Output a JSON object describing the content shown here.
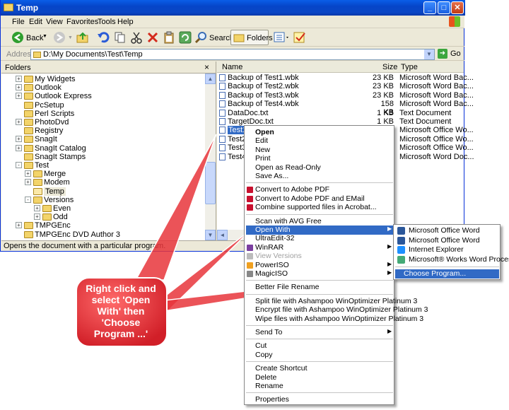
{
  "window": {
    "title": "Temp"
  },
  "menu": [
    "File",
    "Edit",
    "View",
    "Favorites",
    "Tools",
    "Help"
  ],
  "toolbar": {
    "back": "Back",
    "search": "Search",
    "folders": "Folders"
  },
  "address": {
    "label": "Address",
    "path": "D:\\My Documents\\Test\\Temp",
    "go": "Go"
  },
  "folders": {
    "title": "Folders",
    "close": "×",
    "tree": [
      {
        "label": "My Widgets",
        "level": 1,
        "exp": "+"
      },
      {
        "label": "Outlook",
        "level": 1,
        "exp": "+"
      },
      {
        "label": "Outlook Express",
        "level": 1,
        "exp": "+"
      },
      {
        "label": "PcSetup",
        "level": 1,
        "exp": ""
      },
      {
        "label": "Perl Scripts",
        "level": 1,
        "exp": ""
      },
      {
        "label": "PhotoDvd",
        "level": 1,
        "exp": "+"
      },
      {
        "label": "Registry",
        "level": 1,
        "exp": ""
      },
      {
        "label": "SnagIt",
        "level": 1,
        "exp": "+"
      },
      {
        "label": "SnagIt Catalog",
        "level": 1,
        "exp": "+"
      },
      {
        "label": "SnagIt Stamps",
        "level": 1,
        "exp": ""
      },
      {
        "label": "Test",
        "level": 1,
        "exp": "−"
      },
      {
        "label": "Merge",
        "level": 2,
        "exp": "+"
      },
      {
        "label": "Modem",
        "level": 2,
        "exp": "+"
      },
      {
        "label": "Temp",
        "level": 2,
        "exp": "",
        "selected": true
      },
      {
        "label": "Versions",
        "level": 2,
        "exp": "−"
      },
      {
        "label": "Even",
        "level": 3,
        "exp": "+"
      },
      {
        "label": "Odd",
        "level": 3,
        "exp": "+"
      },
      {
        "label": "TMPGEnc",
        "level": 1,
        "exp": "+"
      },
      {
        "label": "TMPGEnc DVD Author 3",
        "level": 1,
        "exp": ""
      }
    ]
  },
  "files": {
    "headers": {
      "name": "Name",
      "size": "Size",
      "type": "Type"
    },
    "rows": [
      {
        "name": "Backup of Test1.wbk",
        "size": "23 KB",
        "type": "Microsoft Word Bac..."
      },
      {
        "name": "Backup of Test2.wbk",
        "size": "23 KB",
        "type": "Microsoft Word Bac..."
      },
      {
        "name": "Backup of Test3.wbk",
        "size": "23 KB",
        "type": "Microsoft Word Bac..."
      },
      {
        "name": "Backup of Test4.wbk",
        "size": "158 KB",
        "type": "Microsoft Word Bac..."
      },
      {
        "name": "DataDoc.txt",
        "size": "1 KB",
        "type": "Text Document"
      },
      {
        "name": "TargetDoc.txt",
        "size": "1 KB",
        "type": "Text Document"
      },
      {
        "name": "Test1.d",
        "size": "",
        "type": "Microsoft Office Wo...",
        "selected": true
      },
      {
        "name": "Test2.",
        "size": "",
        "type": "Microsoft Office Wo..."
      },
      {
        "name": "Test3.",
        "size": "",
        "type": "Microsoft Office Wo..."
      },
      {
        "name": "Test4.",
        "size": "",
        "type": "Microsoft Word Doc..."
      }
    ]
  },
  "status": "Opens the document with a particular program.",
  "context_menu": [
    {
      "label": "Open",
      "bold": true
    },
    {
      "label": "Edit"
    },
    {
      "label": "New"
    },
    {
      "label": "Print"
    },
    {
      "label": "Open as Read-Only"
    },
    {
      "label": "Save As..."
    },
    {
      "sep": true
    },
    {
      "label": "Convert to Adobe PDF",
      "icon": "pdf-icon"
    },
    {
      "label": "Convert to Adobe PDF and EMail",
      "icon": "pdf-email-icon"
    },
    {
      "label": "Combine supported files in Acrobat...",
      "icon": "acrobat-icon"
    },
    {
      "sep": true
    },
    {
      "label": "Scan with AVG Free"
    },
    {
      "label": "Open With",
      "submenu": true,
      "highlight": true
    },
    {
      "label": "UltraEdit-32"
    },
    {
      "label": "WinRAR",
      "icon": "winrar-icon",
      "submenu": true
    },
    {
      "label": "View Versions",
      "disabled": true,
      "icon": "versions-icon"
    },
    {
      "label": "PowerISO",
      "icon": "poweriso-icon",
      "submenu": true
    },
    {
      "label": "MagicISO",
      "icon": "magiciso-icon",
      "submenu": true
    },
    {
      "sep": true
    },
    {
      "label": "Better File Rename"
    },
    {
      "sep": true
    },
    {
      "label": "Split file with Ashampoo WinOptimizer Platinum 3"
    },
    {
      "label": "Encrypt file with Ashampoo WinOptimizer Platinum 3"
    },
    {
      "label": "Wipe files with Ashampoo WinOptimizer Platinum 3"
    },
    {
      "sep": true
    },
    {
      "label": "Send To",
      "submenu": true
    },
    {
      "sep": true
    },
    {
      "label": "Cut"
    },
    {
      "label": "Copy"
    },
    {
      "sep": true
    },
    {
      "label": "Create Shortcut"
    },
    {
      "label": "Delete"
    },
    {
      "label": "Rename"
    },
    {
      "sep": true
    },
    {
      "label": "Properties"
    }
  ],
  "open_with_menu": [
    {
      "label": "Microsoft Office Word",
      "icon": "word-icon"
    },
    {
      "label": "Microsoft Office Word",
      "icon": "word-icon"
    },
    {
      "label": "Internet Explorer",
      "icon": "ie-icon"
    },
    {
      "label": "Microsoft® Works Word Processor",
      "icon": "works-icon"
    },
    {
      "sep": true
    },
    {
      "label": "Choose Program...",
      "highlight": true
    }
  ],
  "callout": {
    "text": "Right click and select 'Open With' then 'Choose Program ...'",
    "color": "#e8353b"
  }
}
